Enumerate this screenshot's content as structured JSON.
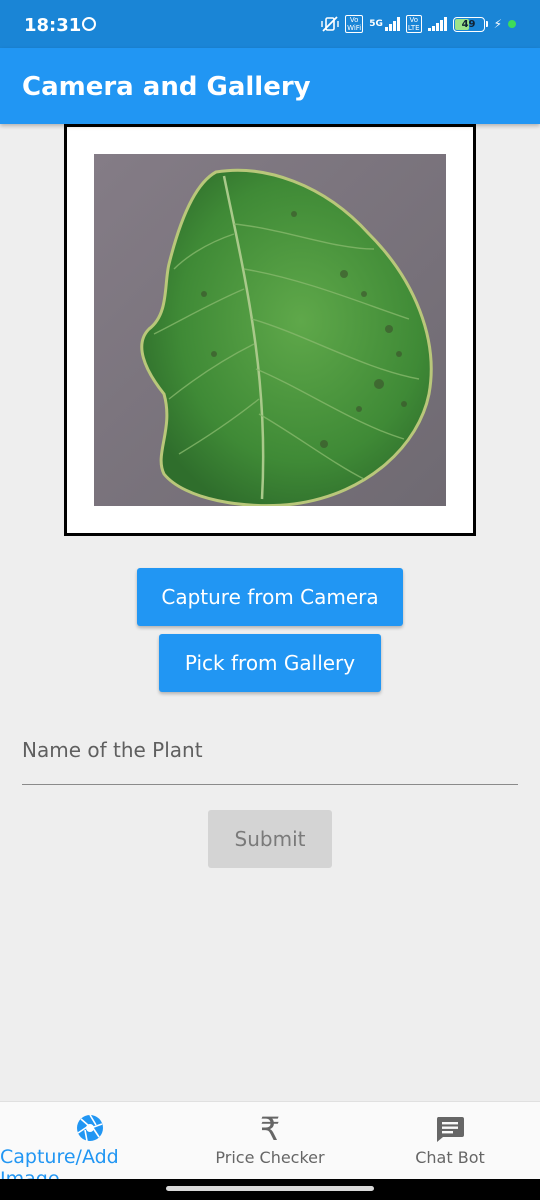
{
  "status_bar": {
    "time": "18:31",
    "network_label": "5G",
    "sim1_badge": "Vo\nWiFi",
    "sim2_badge": "Vo\nLTE",
    "battery_percent": "49",
    "battery_level": 0.49
  },
  "app_bar": {
    "title": "Camera and Gallery",
    "color": "#2196f3"
  },
  "image_preview": {
    "content": "leaf-photo"
  },
  "buttons": {
    "camera_label": "Capture from Camera",
    "gallery_label": "Pick from Gallery",
    "submit_label": "Submit"
  },
  "plant_name_field": {
    "placeholder": "Name of the Plant",
    "value": ""
  },
  "bottom_nav": {
    "items": [
      {
        "label": "Capture/Add Image",
        "icon": "camera-shutter-icon",
        "active": true
      },
      {
        "label": "Price Checker",
        "icon": "rupee-icon",
        "active": false
      },
      {
        "label": "Chat Bot",
        "icon": "chat-icon",
        "active": false
      }
    ],
    "active_color": "#2196f3"
  }
}
